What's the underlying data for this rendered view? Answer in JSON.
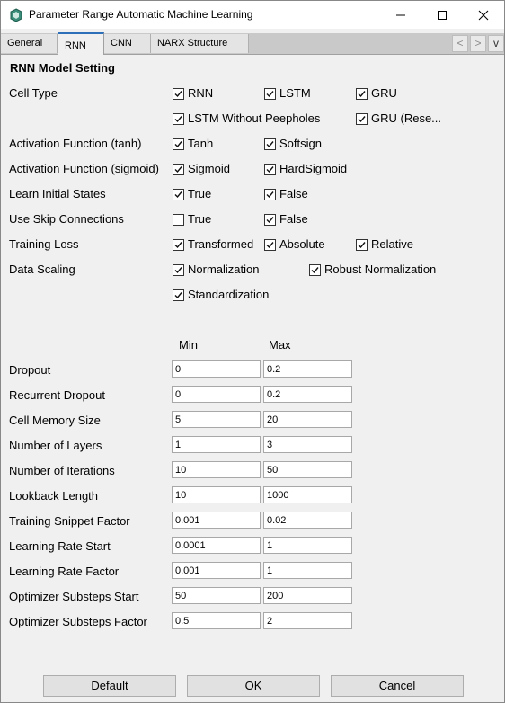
{
  "window": {
    "title": "Parameter Range Automatic Machine Learning"
  },
  "tabs": [
    {
      "label": "General",
      "active": false
    },
    {
      "label": "RNN",
      "active": true
    },
    {
      "label": "CNN",
      "active": false
    },
    {
      "label": "NARX Structure",
      "active": false
    }
  ],
  "tab_nav": {
    "prev": "<",
    "next": ">",
    "menu": "v"
  },
  "section_title": "RNN Model Setting",
  "cell_type": {
    "label": "Cell Type",
    "options": [
      {
        "label": "RNN",
        "checked": true
      },
      {
        "label": "LSTM",
        "checked": true
      },
      {
        "label": "GRU",
        "checked": true
      },
      {
        "label": "LSTM Without Peepholes",
        "checked": true
      },
      {
        "label": "GRU (Rese...",
        "checked": true
      }
    ]
  },
  "act_tanh": {
    "label": "Activation Function (tanh)",
    "options": [
      {
        "label": "Tanh",
        "checked": true
      },
      {
        "label": "Softsign",
        "checked": true
      }
    ]
  },
  "act_sigmoid": {
    "label": "Activation Function (sigmoid)",
    "options": [
      {
        "label": "Sigmoid",
        "checked": true
      },
      {
        "label": "HardSigmoid",
        "checked": true
      }
    ]
  },
  "learn_init": {
    "label": "Learn Initial States",
    "options": [
      {
        "label": "True",
        "checked": true
      },
      {
        "label": "False",
        "checked": true
      }
    ]
  },
  "skip_conn": {
    "label": "Use Skip Connections",
    "options": [
      {
        "label": "True",
        "checked": false
      },
      {
        "label": "False",
        "checked": true
      }
    ]
  },
  "training_loss": {
    "label": "Training Loss",
    "options": [
      {
        "label": "Transformed",
        "checked": true
      },
      {
        "label": "Absolute",
        "checked": true
      },
      {
        "label": "Relative",
        "checked": true
      }
    ]
  },
  "data_scaling": {
    "label": "Data Scaling",
    "options": [
      {
        "label": "Normalization",
        "checked": true
      },
      {
        "label": "Robust Normalization",
        "checked": true
      },
      {
        "label": "Standardization",
        "checked": true
      }
    ]
  },
  "ranges": {
    "min_header": "Min",
    "max_header": "Max",
    "rows": [
      {
        "label": "Dropout",
        "min": "0",
        "max": "0.2"
      },
      {
        "label": "Recurrent Dropout",
        "min": "0",
        "max": "0.2"
      },
      {
        "label": "Cell Memory Size",
        "min": "5",
        "max": "20"
      },
      {
        "label": "Number of Layers",
        "min": "1",
        "max": "3"
      },
      {
        "label": "Number of Iterations",
        "min": "10",
        "max": "50"
      },
      {
        "label": "Lookback Length",
        "min": "10",
        "max": "1000"
      },
      {
        "label": "Training Snippet Factor",
        "min": "0.001",
        "max": "0.02"
      },
      {
        "label": "Learning Rate Start",
        "min": "0.0001",
        "max": "1"
      },
      {
        "label": "Learning Rate Factor",
        "min": "0.001",
        "max": "1"
      },
      {
        "label": "Optimizer Substeps Start",
        "min": "50",
        "max": "200"
      },
      {
        "label": "Optimizer Substeps Factor",
        "min": "0.5",
        "max": "2"
      }
    ]
  },
  "buttons": {
    "default": "Default",
    "ok": "OK",
    "cancel": "Cancel"
  },
  "icons": {
    "app": "app-icon",
    "minimize": "minimize-icon",
    "maximize": "maximize-icon",
    "close": "close-icon"
  }
}
